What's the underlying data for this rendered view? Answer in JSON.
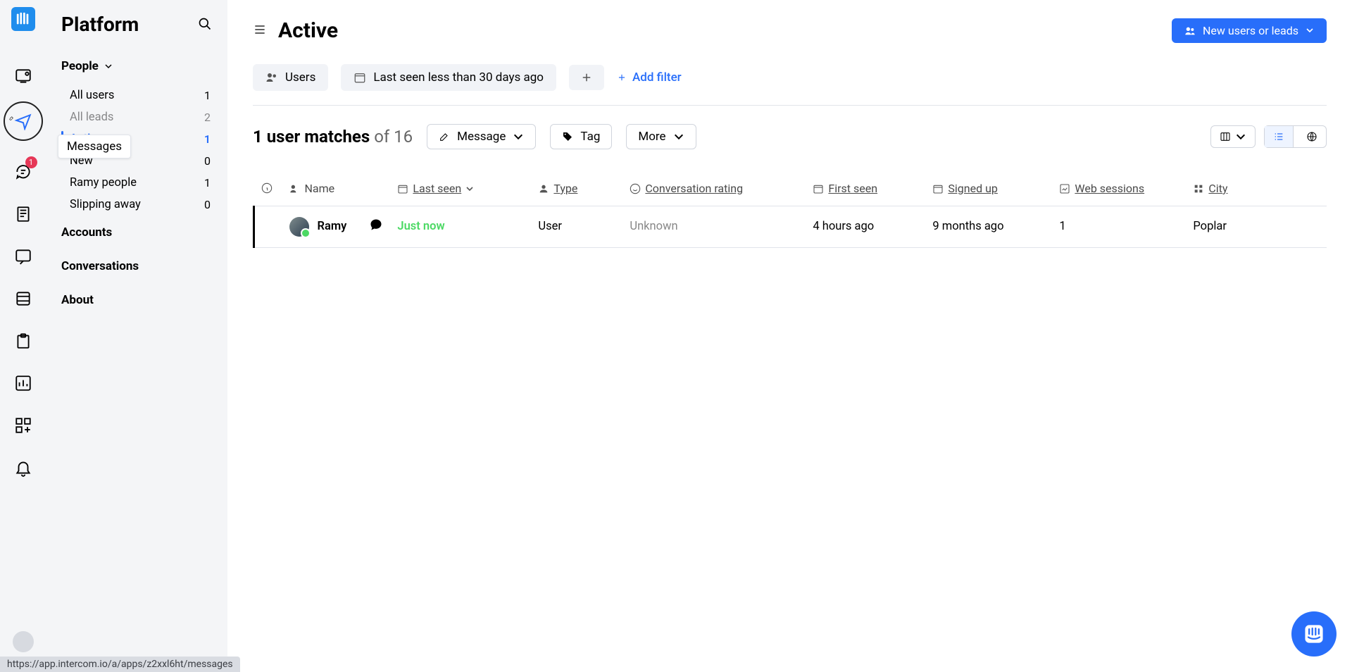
{
  "tooltip": {
    "messages_label": "Messages"
  },
  "rail": {
    "badge": "1"
  },
  "sidebar": {
    "title": "Platform",
    "people_section": "People",
    "items": [
      {
        "label": "All users",
        "count": "1"
      },
      {
        "label": "All leads",
        "count": "2"
      },
      {
        "label": "Active",
        "count": "1"
      },
      {
        "label": "New",
        "count": "0"
      },
      {
        "label": "Ramy people",
        "count": "1"
      },
      {
        "label": "Slipping away",
        "count": "0"
      }
    ],
    "accounts": "Accounts",
    "conversations": "Conversations",
    "about": "About"
  },
  "main": {
    "title": "Active",
    "new_users_btn": "New users or leads",
    "filters": {
      "users": "Users",
      "lastseen": "Last seen less than 30 days ago",
      "addfilter": "Add filter"
    },
    "matches_count": "1 user matches",
    "matches_of": "of 16",
    "message_btn": "Message",
    "tag_btn": "Tag",
    "more_btn": "More"
  },
  "table": {
    "cols": {
      "name": "Name",
      "lastseen": "Last seen",
      "type": "Type",
      "convrating": "Conversation rating",
      "firstseen": "First seen",
      "signedup": "Signed up",
      "websessions": "Web sessions",
      "city": "City"
    },
    "row": {
      "name": "Ramy",
      "lastseen": "Just now",
      "type": "User",
      "convrating": "Unknown",
      "firstseen": "4 hours ago",
      "signedup": "9 months ago",
      "websessions": "1",
      "city": "Poplar"
    }
  },
  "urlbar": "https://app.intercom.io/a/apps/z2xxl6ht/messages"
}
